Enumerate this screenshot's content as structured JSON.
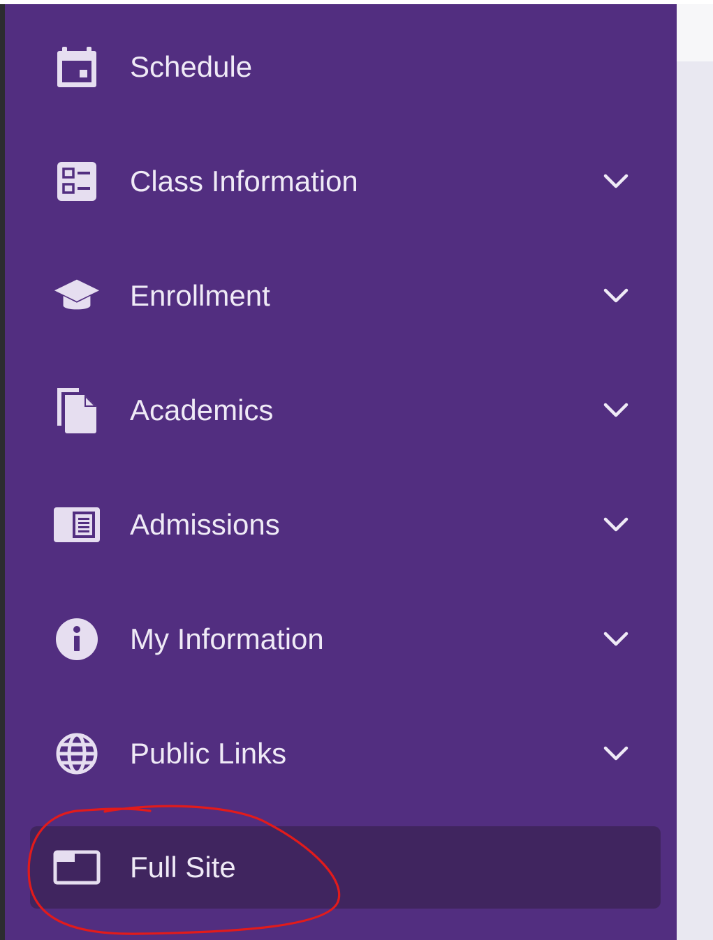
{
  "sidebar": {
    "items": [
      {
        "label": "Schedule",
        "icon": "calendar-icon",
        "expandable": false
      },
      {
        "label": "Class Information",
        "icon": "list-alt-icon",
        "expandable": true
      },
      {
        "label": "Enrollment",
        "icon": "graduation-cap-icon",
        "expandable": true
      },
      {
        "label": "Academics",
        "icon": "documents-icon",
        "expandable": true
      },
      {
        "label": "Admissions",
        "icon": "newspaper-icon",
        "expandable": true
      },
      {
        "label": "My Information",
        "icon": "info-icon",
        "expandable": true
      },
      {
        "label": "Public Links",
        "icon": "globe-icon",
        "expandable": true
      },
      {
        "label": "Full Site",
        "icon": "window-icon",
        "expandable": false,
        "active": true
      }
    ]
  },
  "colors": {
    "sidebar_bg": "#522e80",
    "active_item_bg": "#40255f",
    "text": "#efeaf6",
    "annotation_stroke": "#e21b1b"
  }
}
